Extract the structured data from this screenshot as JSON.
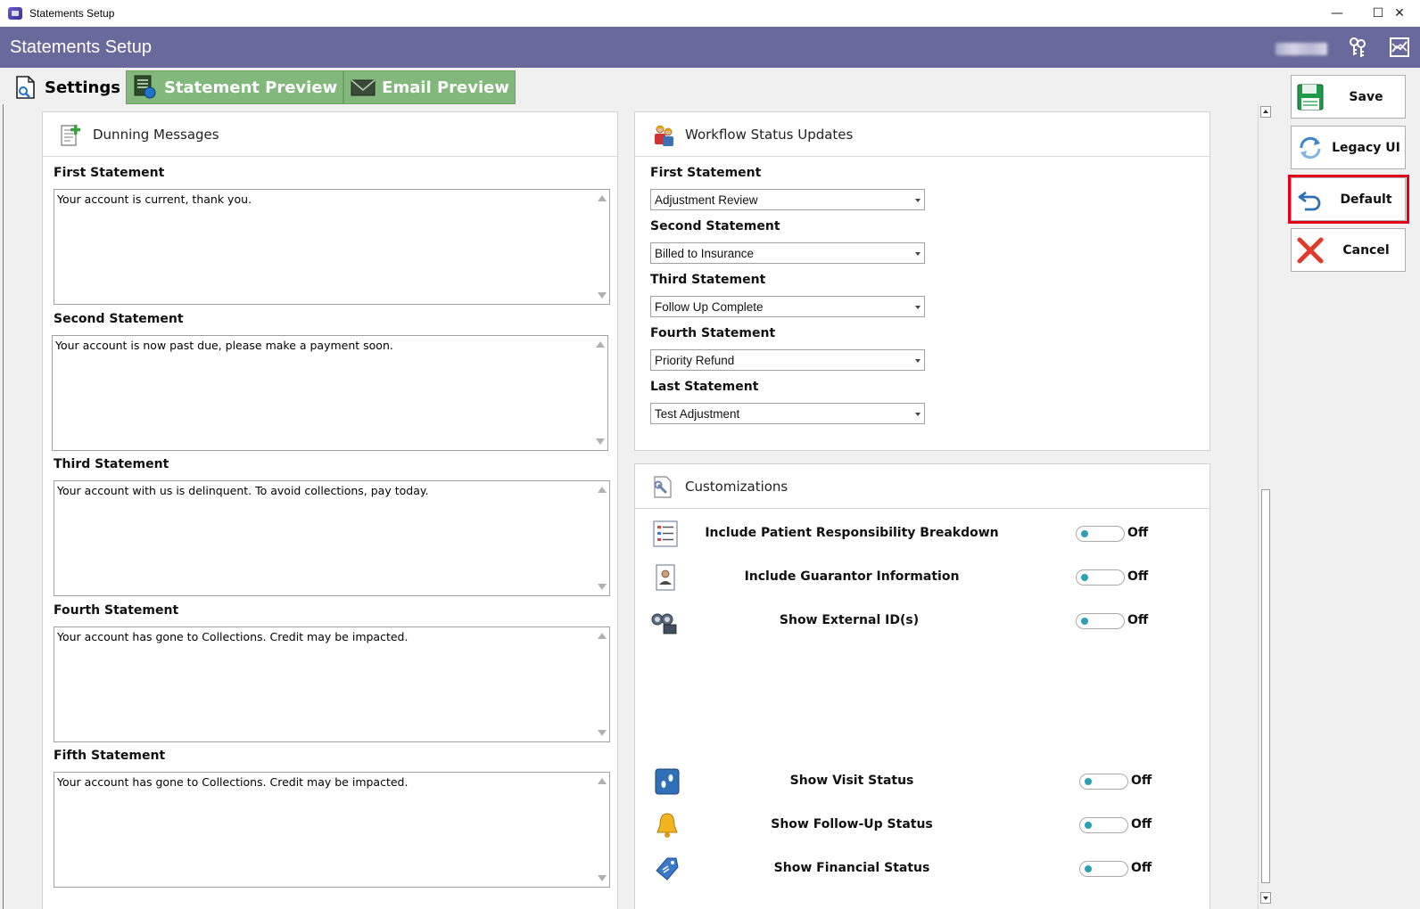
{
  "window": {
    "title": "Statements Setup",
    "minimize": "—",
    "maximize": "☐",
    "close": "✕"
  },
  "header": {
    "title": "Statements Setup"
  },
  "tabs": [
    {
      "label": "Settings",
      "active": true,
      "icon": "settings-doc-icon"
    },
    {
      "label": "Statement Preview",
      "active": false,
      "icon": "statement-preview-icon"
    },
    {
      "label": "Email Preview",
      "active": false,
      "icon": "email-icon"
    }
  ],
  "dunning": {
    "title": "Dunning Messages",
    "items": [
      {
        "label": "First Statement",
        "text": "Your account is current, thank you."
      },
      {
        "label": "Second Statement",
        "text": "Your account is now past due, please make a payment soon."
      },
      {
        "label": "Third Statement",
        "text": "Your account with us is delinquent. To avoid collections, pay today."
      },
      {
        "label": "Fourth Statement",
        "text": "Your account has gone to Collections. Credit may be impacted."
      },
      {
        "label": "Fifth Statement",
        "text": "Your account has gone to Collections. Credit may be impacted."
      }
    ]
  },
  "workflow": {
    "title": "Workflow Status Updates",
    "items": [
      {
        "label": "First Statement",
        "value": "Adjustment Review"
      },
      {
        "label": "Second Statement",
        "value": "Billed to Insurance"
      },
      {
        "label": "Third Statement",
        "value": "Follow Up Complete"
      },
      {
        "label": "Fourth Statement",
        "value": "Priority Refund"
      },
      {
        "label": "Last Statement",
        "value": "Test Adjustment"
      }
    ]
  },
  "customizations": {
    "title": "Customizations",
    "items": [
      {
        "label": "Include Patient Responsibility Breakdown",
        "state": "Off",
        "icon": "list-icon"
      },
      {
        "label": "Include Guarantor Information",
        "state": "Off",
        "icon": "id-card-icon"
      },
      {
        "label": "Show External ID(s)",
        "state": "Off",
        "icon": "binoculars-id-icon"
      },
      {
        "label": "Show Visit Status",
        "state": "Off",
        "icon": "footprints-icon"
      },
      {
        "label": "Show Follow-Up Status",
        "state": "Off",
        "icon": "bell-icon"
      },
      {
        "label": "Show Financial Status",
        "state": "Off",
        "icon": "price-tag-icon"
      }
    ]
  },
  "side_buttons": {
    "save": "Save",
    "legacy": "Legacy UI",
    "default": "Default",
    "cancel": "Cancel"
  },
  "colors": {
    "header": "#696a9b",
    "tab_inactive": "#82b87b",
    "toggle_knob": "#2aa0b4",
    "highlight": "#e3001b"
  }
}
